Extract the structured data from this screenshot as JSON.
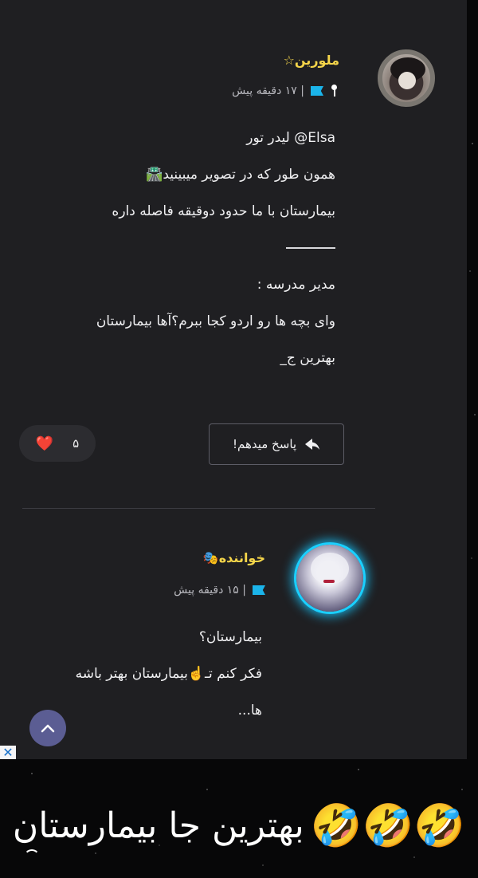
{
  "comments": [
    {
      "username": "ملورین☆",
      "time": "| ۱۷ دقیقه پیش",
      "lines": [
        "Elsa@ لیدر تور",
        "همون طور که در تصویر میبینید🛣️",
        "بیمارستان با ما حدود دوقیقه فاصله داره",
        "",
        "مدیر مدرسه :",
        "وای بچه ها رو اردو کجا ببرم؟آها بیمارستان",
        "بهترین ج_"
      ],
      "reply_label": "پاسخ میدهم!",
      "like_count": "۵",
      "like_icon": "❤️"
    },
    {
      "username": "خواننده🎭",
      "time": "| ۱۵ دقیقه پیش",
      "lines": [
        "بیمارستان؟",
        "فکر کنم تـ☝️بیمارستان بهتر باشه",
        "ها..."
      ]
    }
  ],
  "caption": {
    "text": "بهترین جا بیمارستان",
    "emoji": "🤣🤣🤣"
  },
  "colors": {
    "panel": "#1f1f22",
    "username": "#f5d54a",
    "flag": "#1bb4ea",
    "heart": "#e8232f",
    "scroll_button": "#5b5d93"
  },
  "icons": {
    "pin": "pin-icon",
    "flag": "flag-icon",
    "reply": "reply-arrow-icon",
    "heart": "heart-icon",
    "scroll_up": "chevron-up-icon",
    "close": "close-icon"
  }
}
